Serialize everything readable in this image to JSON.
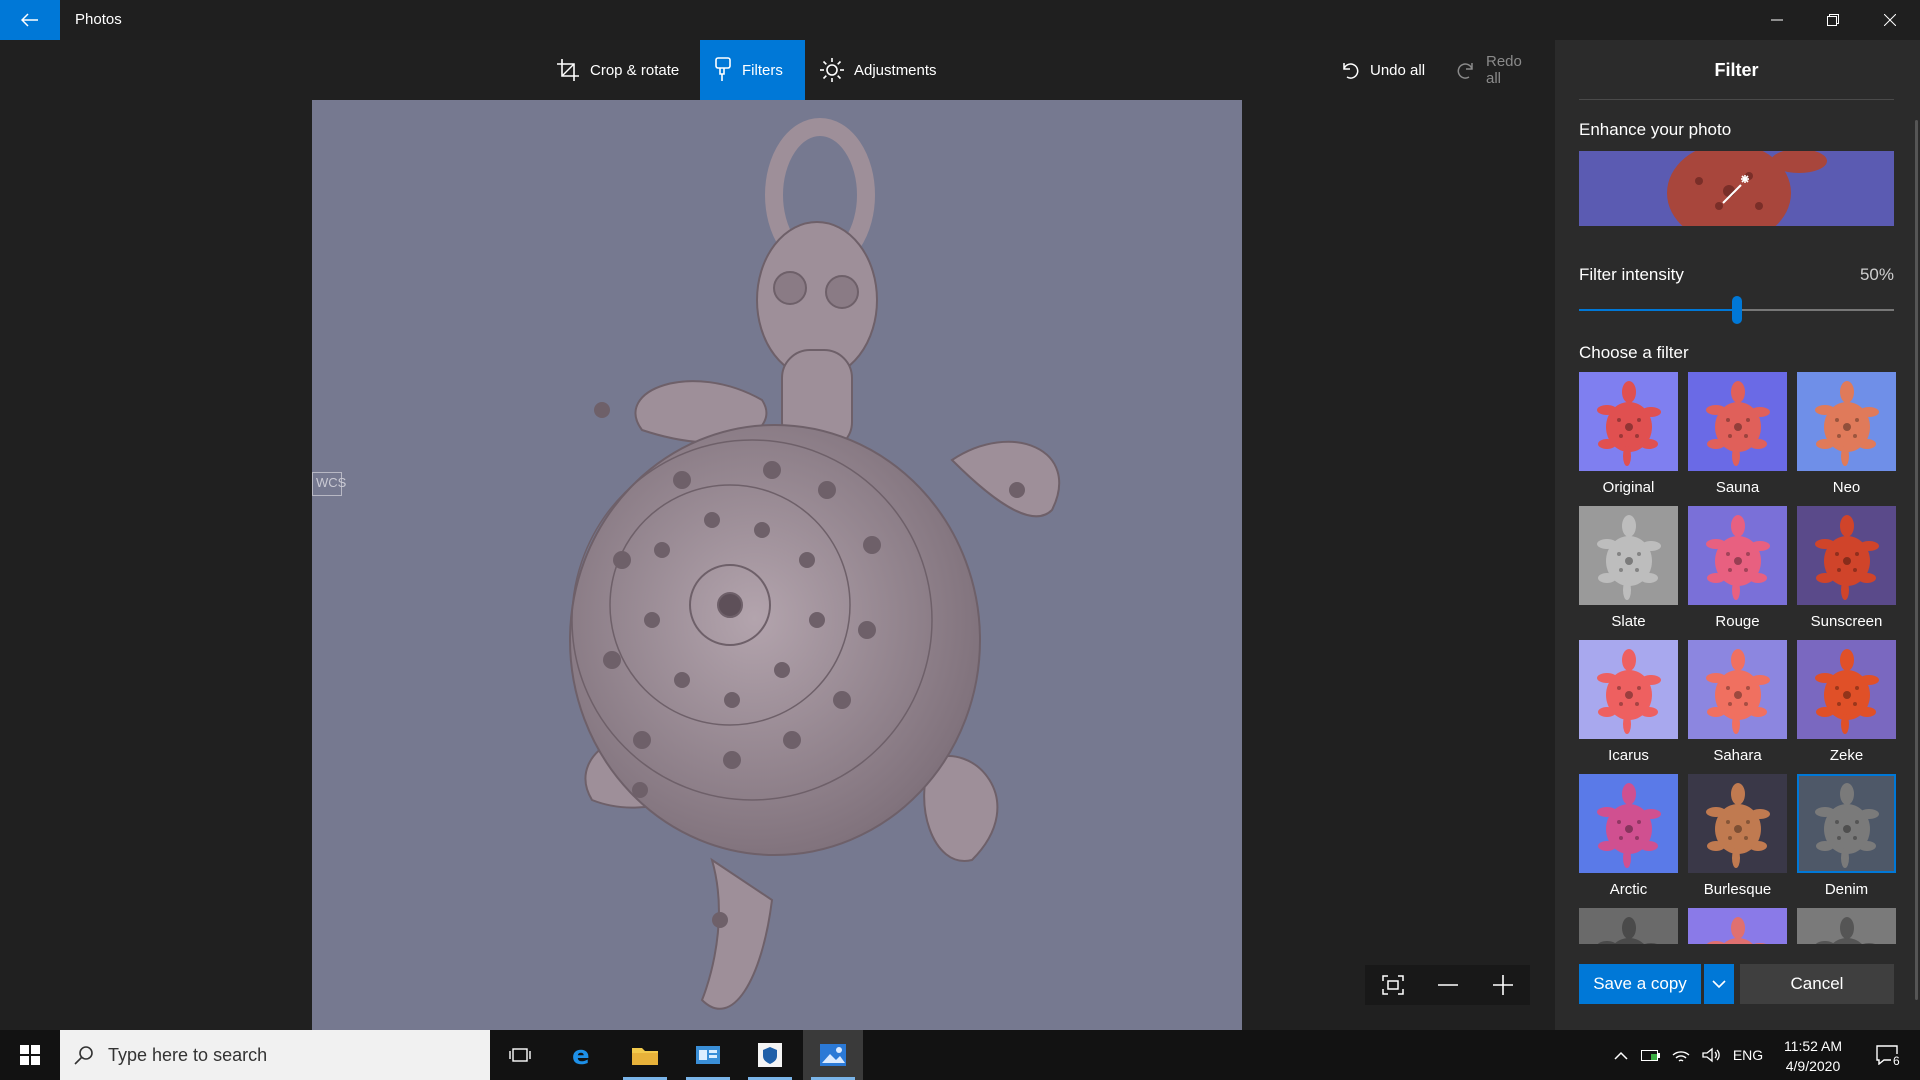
{
  "app": {
    "title": "Photos"
  },
  "toolbar": {
    "crop_label": "Crop & rotate",
    "filters_label": "Filters",
    "adjustments_label": "Adjustments",
    "undo_label": "Undo all",
    "redo_label": "Redo all"
  },
  "photo": {
    "axis_label": "WCS"
  },
  "panel": {
    "title": "Filter",
    "enhance_label": "Enhance your photo",
    "intensity_label": "Filter intensity",
    "intensity_value": "50%",
    "intensity_level": 0.5,
    "choose_label": "Choose a filter",
    "filters": [
      {
        "name": "Original",
        "bg": "#7f7ff0",
        "fg": "#e05050"
      },
      {
        "name": "Sauna",
        "bg": "#6a6ae6",
        "fg": "#e0605a"
      },
      {
        "name": "Neo",
        "bg": "#6f8fe8",
        "fg": "#e07a5a"
      },
      {
        "name": "Slate",
        "bg": "#9a9a9a",
        "fg": "#bdbdbd"
      },
      {
        "name": "Rouge",
        "bg": "#7a70d8",
        "fg": "#e86080"
      },
      {
        "name": "Sunscreen",
        "bg": "#5a4a8a",
        "fg": "#d0442a"
      },
      {
        "name": "Icarus",
        "bg": "#a8a8ee",
        "fg": "#ee6060"
      },
      {
        "name": "Sahara",
        "bg": "#8c86e0",
        "fg": "#f07060"
      },
      {
        "name": "Zeke",
        "bg": "#7a68c0",
        "fg": "#e05028"
      },
      {
        "name": "Arctic",
        "bg": "#5a7ae8",
        "fg": "#d05090"
      },
      {
        "name": "Burlesque",
        "bg": "#3a3848",
        "fg": "#c07a50"
      },
      {
        "name": "Denim",
        "bg": "#4e5868",
        "fg": "#7a7a7a",
        "selected": true
      },
      {
        "name": "",
        "bg": "#6a6a6a",
        "fg": "#4a4a4a"
      },
      {
        "name": "",
        "bg": "#8a7ae8",
        "fg": "#e07070"
      },
      {
        "name": "",
        "bg": "#7a7a7a",
        "fg": "#555555"
      }
    ],
    "save_label": "Save a copy",
    "cancel_label": "Cancel"
  },
  "taskbar": {
    "search_placeholder": "Type here to search",
    "language": "ENG",
    "time": "11:52 AM",
    "date": "4/9/2020",
    "notification_count": "6"
  },
  "colors": {
    "accent": "#0078d7",
    "photo_background": "#767990",
    "turtle": "#9e8f99"
  }
}
